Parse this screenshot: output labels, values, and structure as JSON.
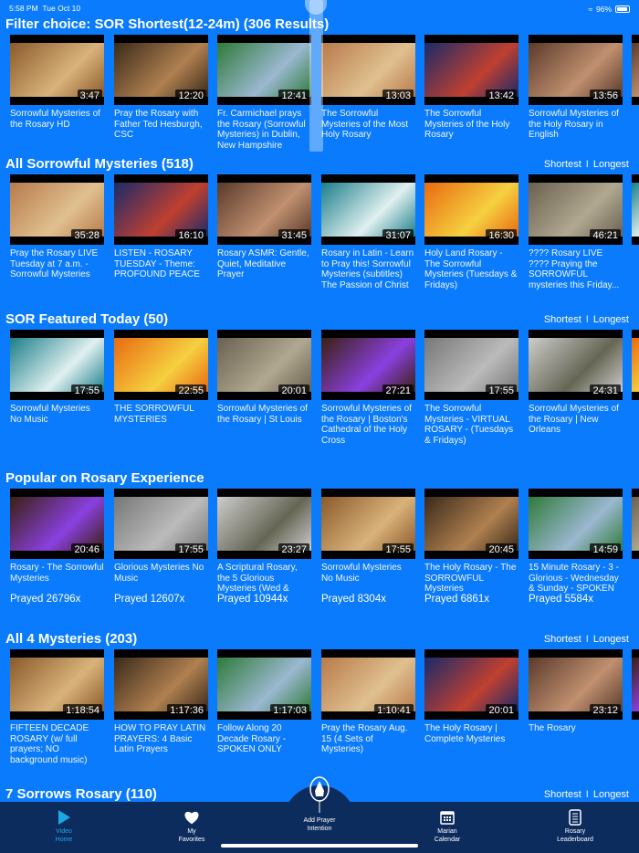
{
  "status_bar": {
    "time": "5:58 PM",
    "date": "Tue Oct 10",
    "battery": "96%"
  },
  "sort": {
    "shortest": "Shortest",
    "separator": "I",
    "longest": "Longest"
  },
  "sections": [
    {
      "title": "Filter choice: SOR Shortest(12-24m) (306 Results)",
      "has_sort": false,
      "videos": [
        {
          "title": "Sorrowful Mysteries of the Rosary HD",
          "duration": "3:47"
        },
        {
          "title": "Pray the Rosary with Father Ted Hesburgh, CSC",
          "duration": "12:20"
        },
        {
          "title": "Fr. Carmichael prays the Rosary (Sorrowful Mysteries) in Dublin, New Hampshire",
          "duration": "12:41"
        },
        {
          "title": "The Sorrowful Mysteries of the Most Holy Rosary",
          "duration": "13:03"
        },
        {
          "title": "The Sorrowful Mysteries of the Holy Rosary",
          "duration": "13:42"
        },
        {
          "title": "Sorrowful Mysteries of the Holy Rosary in English",
          "duration": "13:56"
        }
      ]
    },
    {
      "title": "All Sorrowful Mysteries (518)",
      "has_sort": true,
      "videos": [
        {
          "title": "Pray the Rosary LIVE Tuesday at 7 a.m. - Sorrowful Mysteries",
          "duration": "35:28"
        },
        {
          "title": "LISTEN - ROSARY TUESDAY - Theme: PROFOUND PEACE",
          "duration": "16:10"
        },
        {
          "title": "Rosary ASMR: Gentle, Quiet, Meditative Prayer",
          "duration": "31:45"
        },
        {
          "title": "Rosary in Latin - Learn to Pray this! Sorrowful Mysteries (subtitles) The Passion of Christ",
          "duration": "31:07"
        },
        {
          "title": "Holy Land Rosary - The Sorrowful Mysteries (Tuesdays & Fridays)",
          "duration": "16:30"
        },
        {
          "title": "???? Rosary LIVE ???? Praying the SORROWFUL mysteries this Friday...",
          "duration": "46:21"
        }
      ]
    },
    {
      "title": "SOR Featured Today (50)",
      "has_sort": true,
      "videos": [
        {
          "title": "Sorrowful Mysteries No Music",
          "duration": "17:55"
        },
        {
          "title": "THE SORROWFUL MYSTERIES",
          "duration": "22:55"
        },
        {
          "title": "Sorrowful Mysteries of the Rosary  | St Louis",
          "duration": "20:01"
        },
        {
          "title": "Sorrowful Mysteries of the Rosary | Boston's Cathedral of the Holy Cross",
          "duration": "27:21"
        },
        {
          "title": "The Sorrowful Mysteries - VIRTUAL ROSARY - (Tuesdays & Fridays)",
          "duration": "17:55"
        },
        {
          "title": "Sorrowful Mysteries of the Rosary | New Orleans",
          "duration": "24:31"
        }
      ]
    },
    {
      "title": "Popular on Rosary Experience",
      "has_sort": false,
      "videos": [
        {
          "title": "Rosary - The Sorrowful Mysteries",
          "duration": "20:46",
          "prayed": "Prayed 26796x"
        },
        {
          "title": "Glorious Mysteries No Music",
          "duration": "17:55",
          "prayed": "Prayed 12607x"
        },
        {
          "title": "A Scriptural Rosary, the 5 Glorious Mysteries (Wed &",
          "duration": "23:27",
          "prayed": "Prayed 10944x"
        },
        {
          "title": "Sorrowful Mysteries No Music",
          "duration": "17:55",
          "prayed": "Prayed 8304x"
        },
        {
          "title": "The Holy Rosary - The SORROWFUL Mysteries",
          "duration": "20:45",
          "prayed": "Prayed 6861x"
        },
        {
          "title": "15 Minute Rosary - 3 - Glorious - Wednesday & Sunday - SPOKEN",
          "duration": "14:59",
          "prayed": "Prayed 5584x"
        }
      ]
    },
    {
      "title": "All 4 Mysteries (203)",
      "has_sort": true,
      "videos": [
        {
          "title": "FIFTEEN DECADE ROSARY (w/ full prayers; NO background music)",
          "duration": "1:18:54"
        },
        {
          "title": "HOW TO PRAY LATIN PRAYERS: 4 Basic Latin Prayers",
          "duration": "1:17:36"
        },
        {
          "title": "Follow Along 20 Decade Rosary - SPOKEN ONLY",
          "duration": "1:17:03"
        },
        {
          "title": "Pray the Rosary Aug. 15 (4 Sets of Mysteries)",
          "duration": "1:10:41"
        },
        {
          "title": "The Holy Rosary | Complete Mysteries",
          "duration": "20:01"
        },
        {
          "title": "The Rosary",
          "duration": "23:12"
        }
      ]
    },
    {
      "title": "7 Sorrows Rosary (110)",
      "has_sort": true,
      "videos": []
    }
  ],
  "tabs": [
    {
      "label1": "Video",
      "label2": "Home",
      "icon": "play-icon",
      "active": true
    },
    {
      "label1": "My",
      "label2": "Favorites",
      "icon": "heart-icon"
    },
    {
      "label1": "Add Prayer",
      "label2": "Intention",
      "icon": "praying-hands-icon"
    },
    {
      "label1": "Marian",
      "label2": "Calendar",
      "icon": "calendar-icon"
    },
    {
      "label1": "Rosary",
      "label2": "Leaderboard",
      "icon": "leaderboard-icon"
    }
  ]
}
